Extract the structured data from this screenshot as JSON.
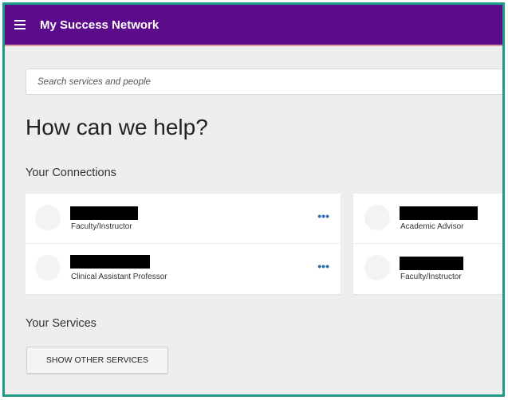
{
  "header": {
    "menu_icon": "hamburger-menu-icon",
    "title": "My Success Network",
    "background_color": "#5c0b8a"
  },
  "search": {
    "placeholder": "Search services and people",
    "value": ""
  },
  "main": {
    "heading": "How can we help?",
    "connections_title": "Your Connections",
    "services_title": "Your Services",
    "show_services_label": "SHOW OTHER SERVICES"
  },
  "connections": [
    {
      "name": "",
      "role": "Faculty/Instructor",
      "has_more_menu": true
    },
    {
      "name": "",
      "role": "Clinical Assistant Professor",
      "has_more_menu": true
    },
    {
      "name": "",
      "role": "Academic Advisor",
      "has_more_menu": false
    },
    {
      "name": "",
      "role": "Faculty/Instructor",
      "has_more_menu": false
    }
  ],
  "icons": {
    "more": "more-options-icon",
    "avatar": "avatar-placeholder"
  },
  "colors": {
    "accent_link": "#2e6fb3",
    "frame_border": "#1e9b86",
    "redaction": "#000000"
  }
}
